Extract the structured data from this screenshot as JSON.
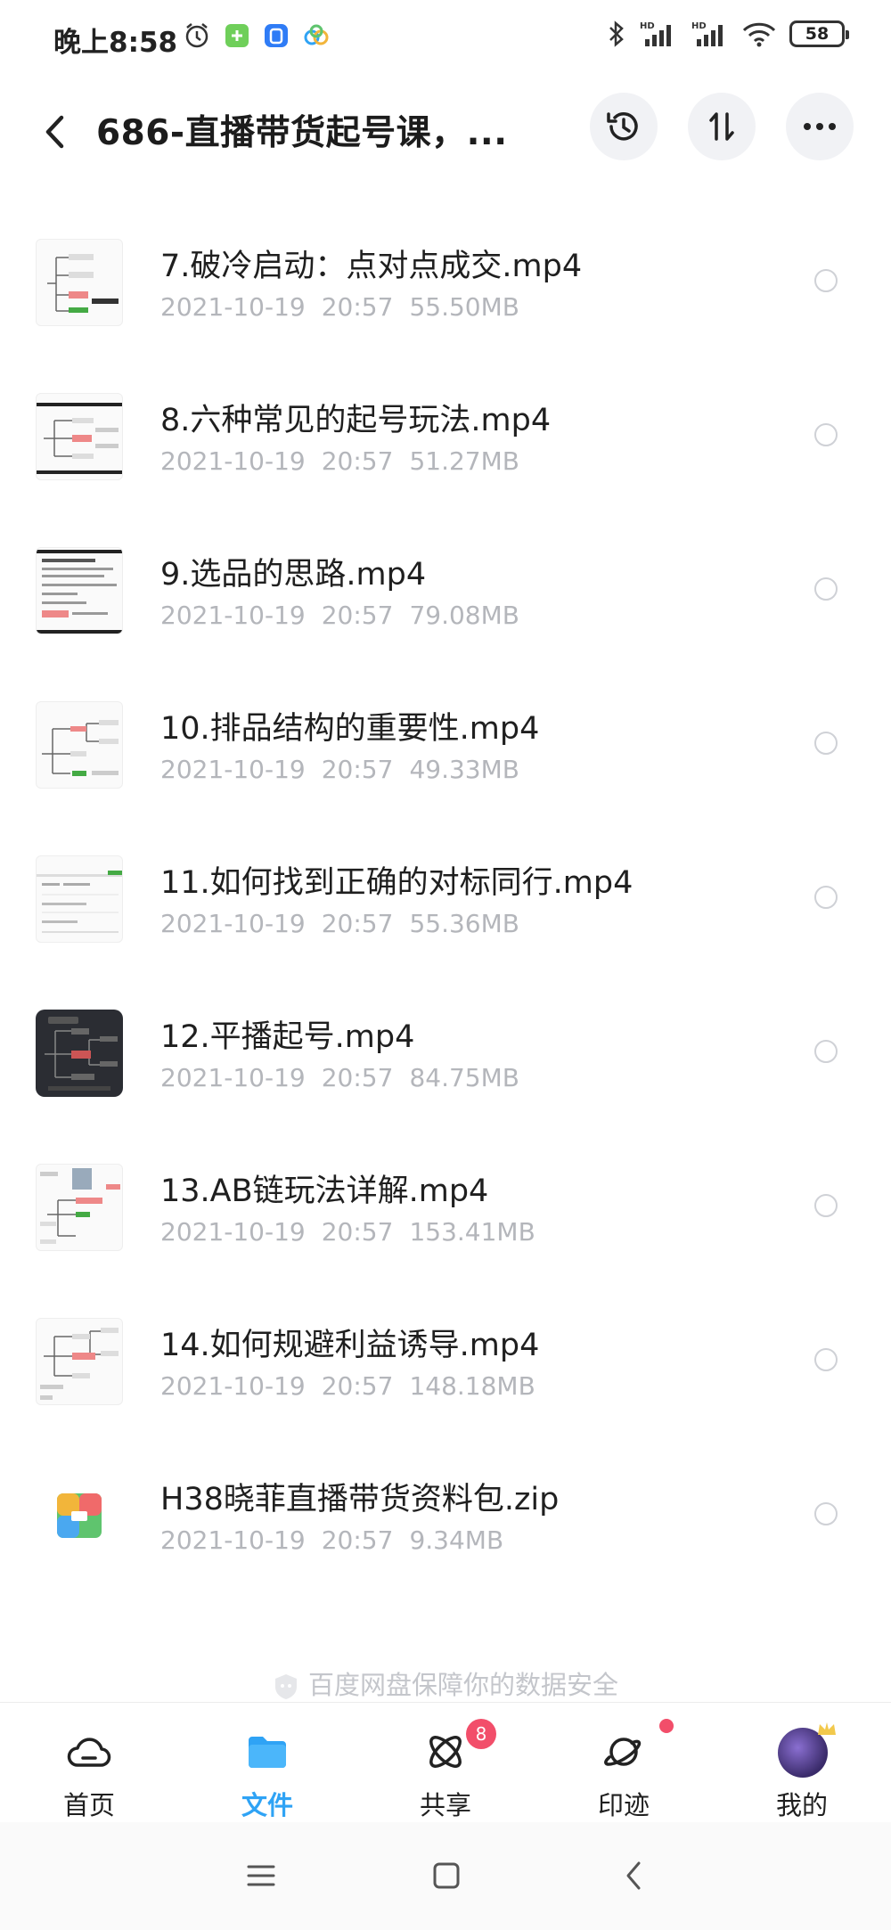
{
  "status_bar": {
    "time": "晚上8:58",
    "battery": "58",
    "left_icons": [
      "alarm-icon",
      "app-green-icon",
      "app-blue-icon",
      "app-cloud-icon"
    ],
    "right_icons": [
      "bluetooth-icon",
      "signal-hd-icon",
      "signal-hd-icon",
      "wifi-icon",
      "battery-icon"
    ]
  },
  "nav": {
    "title": "686-直播带货起号课，...",
    "icons": [
      "back-icon",
      "history-icon",
      "sort-icon",
      "more-icon"
    ]
  },
  "files": [
    {
      "name": "7.破冷启动：点对点成交.mp4",
      "date": "2021-10-19",
      "time": "20:57",
      "size": "55.50MB",
      "thumb": "mindmap"
    },
    {
      "name": "8.六种常见的起号玩法.mp4",
      "date": "2021-10-19",
      "time": "20:57",
      "size": "51.27MB",
      "thumb": "mindmap"
    },
    {
      "name": "9.选品的思路.mp4",
      "date": "2021-10-19",
      "time": "20:57",
      "size": "79.08MB",
      "thumb": "text"
    },
    {
      "name": "10.排品结构的重要性.mp4",
      "date": "2021-10-19",
      "time": "20:57",
      "size": "49.33MB",
      "thumb": "mindmap"
    },
    {
      "name": "11.如何找到正确的对标同行.mp4",
      "date": "2021-10-19",
      "time": "20:57",
      "size": "55.36MB",
      "thumb": "screen"
    },
    {
      "name": "12.平播起号.mp4",
      "date": "2021-10-19",
      "time": "20:57",
      "size": "84.75MB",
      "thumb": "dark"
    },
    {
      "name": "13.AB链玩法详解.mp4",
      "date": "2021-10-19",
      "time": "20:57",
      "size": "153.41MB",
      "thumb": "mindmap"
    },
    {
      "name": "14.如何规避利益诱导.mp4",
      "date": "2021-10-19",
      "time": "20:57",
      "size": "148.18MB",
      "thumb": "mindmap"
    },
    {
      "name": "H38晓菲直播带货资料包.zip",
      "date": "2021-10-19",
      "time": "20:57",
      "size": "9.34MB",
      "thumb": "zip"
    }
  ],
  "security_note": "百度网盘保障你的数据安全",
  "tabs": [
    {
      "label": "首页",
      "icon": "cloud-icon",
      "active": false
    },
    {
      "label": "文件",
      "icon": "folder-icon",
      "active": true
    },
    {
      "label": "共享",
      "icon": "share-atom-icon",
      "badge": "8",
      "active": false
    },
    {
      "label": "印迹",
      "icon": "planet-icon",
      "dot": true,
      "active": false
    },
    {
      "label": "我的",
      "icon": "avatar",
      "active": false
    }
  ],
  "colors": {
    "accent": "#2fa3f5",
    "badge": "#f24e6a",
    "meta_text": "#b4b6bb"
  }
}
